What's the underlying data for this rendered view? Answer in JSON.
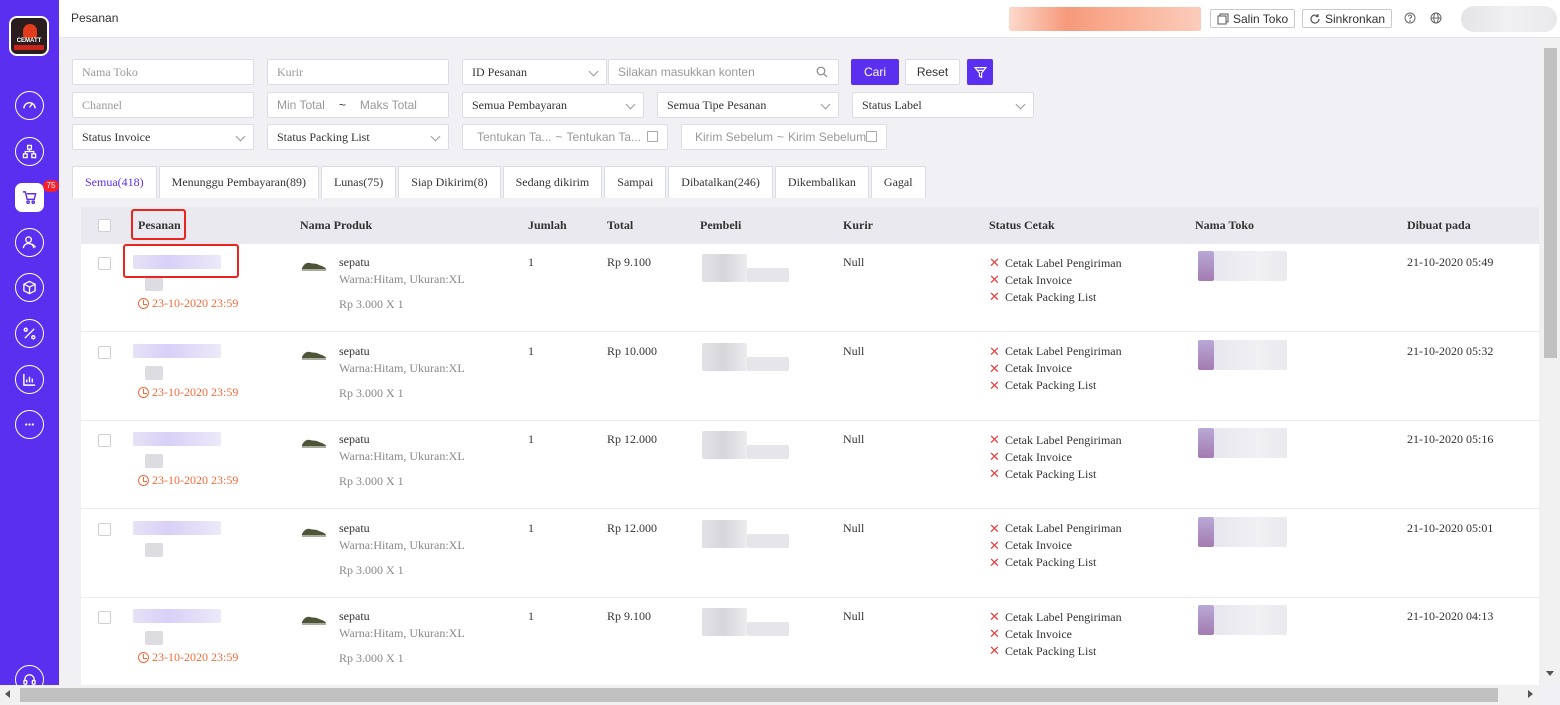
{
  "sidebar": {
    "logo_text": "CEMATT",
    "items": [
      {
        "icon": "dashboard-icon"
      },
      {
        "icon": "sitemap-icon"
      },
      {
        "icon": "cart-icon",
        "badge": "75",
        "active": true
      },
      {
        "icon": "users-icon"
      },
      {
        "icon": "box-icon"
      },
      {
        "icon": "percent-icon"
      },
      {
        "icon": "chart-icon"
      },
      {
        "icon": "chat-icon"
      }
    ],
    "bottom_icon": "headset-icon"
  },
  "header": {
    "title": "Pesanan",
    "copy_store_label": "Salin Toko",
    "sync_label": "Sinkronkan",
    "help_icon": "help-icon",
    "language_icon": "globe-icon"
  },
  "filters": {
    "store_name_placeholder": "Nama Toko",
    "courier_placeholder": "Kurir",
    "search_type_value": "ID Pesanan",
    "search_placeholder": "Silakan masukkan konten",
    "search_button": "Cari",
    "reset_button": "Reset",
    "channel_placeholder": "Channel",
    "min_total_placeholder": "Min Total",
    "range_separator": "~",
    "max_total_placeholder": "Maks Total",
    "payment_value": "Semua Pembayaran",
    "order_type_value": "Semua Tipe Pesanan",
    "label_status_value": "Status Label",
    "invoice_status_value": "Status Invoice",
    "packing_status_value": "Status Packing List",
    "date_start_placeholder": "Tentukan Ta...",
    "date_separator": "~",
    "date_end_placeholder": "Tentukan Ta...",
    "ship_start_placeholder": "Kirim Sebelum",
    "ship_separator": "~",
    "ship_end_placeholder": "Kirim Sebelum"
  },
  "tabs": [
    {
      "label": "Semua(418)",
      "active": true
    },
    {
      "label": "Menunggu Pembayaran(89)"
    },
    {
      "label": "Lunas(75)"
    },
    {
      "label": "Siap Dikirim(8)"
    },
    {
      "label": "Sedang dikirim"
    },
    {
      "label": "Sampai"
    },
    {
      "label": "Dibatalkan(246)"
    },
    {
      "label": "Dikembalikan"
    },
    {
      "label": "Gagal"
    }
  ],
  "table": {
    "columns": [
      "Pesanan",
      "Nama Produk",
      "Jumlah",
      "Total",
      "Pembeli",
      "Kurir",
      "Status Cetak",
      "Nama Toko",
      "Dibuat pada"
    ],
    "rows": [
      {
        "deadline": "23-10-2020 23:59",
        "product": "sepatu",
        "variant": "Warna:Hitam, Ukuran:XL",
        "price_qty": "Rp 3.000 X 1",
        "qty": "1",
        "total": "Rp 9.100",
        "courier": "Null",
        "print_status": [
          "Cetak Label Pengiriman",
          "Cetak Invoice",
          "Cetak Packing List"
        ],
        "created": "21-10-2020 05:49"
      },
      {
        "deadline": "23-10-2020 23:59",
        "product": "sepatu",
        "variant": "Warna:Hitam, Ukuran:XL",
        "price_qty": "Rp 3.000 X 1",
        "qty": "1",
        "total": "Rp 10.000",
        "courier": "Null",
        "print_status": [
          "Cetak Label Pengiriman",
          "Cetak Invoice",
          "Cetak Packing List"
        ],
        "created": "21-10-2020 05:32"
      },
      {
        "deadline": "23-10-2020 23:59",
        "product": "sepatu",
        "variant": "Warna:Hitam, Ukuran:XL",
        "price_qty": "Rp 3.000 X 1",
        "qty": "1",
        "total": "Rp 12.000",
        "courier": "Null",
        "print_status": [
          "Cetak Label Pengiriman",
          "Cetak Invoice",
          "Cetak Packing List"
        ],
        "created": "21-10-2020 05:16"
      },
      {
        "deadline": "",
        "product": "sepatu",
        "variant": "Warna:Hitam, Ukuran:XL",
        "price_qty": "Rp 3.000 X 1",
        "qty": "1",
        "total": "Rp 12.000",
        "courier": "Null",
        "print_status": [
          "Cetak Label Pengiriman",
          "Cetak Invoice",
          "Cetak Packing List"
        ],
        "created": "21-10-2020 05:01"
      },
      {
        "deadline": "23-10-2020 23:59",
        "product": "sepatu",
        "variant": "Warna:Hitam, Ukuran:XL",
        "price_qty": "Rp 3.000 X 1",
        "qty": "1",
        "total": "Rp 9.100",
        "courier": "Null",
        "print_status": [
          "Cetak Label Pengiriman",
          "Cetak Invoice",
          "Cetak Packing List"
        ],
        "created": "21-10-2020 04:13"
      }
    ]
  },
  "colors": {
    "accent": "#5b2ff0",
    "danger": "#e8413f",
    "deadline": "#f26b3a"
  }
}
